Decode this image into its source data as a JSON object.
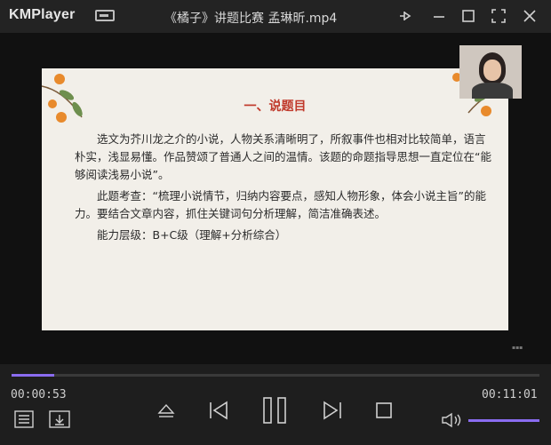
{
  "app": {
    "logo": "KMPlayer",
    "title": "《橘子》讲题比赛 孟琳昕.mp4"
  },
  "slide": {
    "heading": "一、说题目",
    "paragraphs": [
      "选文为芥川龙之介的小说，人物关系清晰明了，所叙事件也相对比较简单，语言朴实，浅显易懂。作品赞颂了普通人之间的温情。该题的命题指导思想一直定位在“能够阅读浅易小说”。",
      "此题考查：“梳理小说情节，归纳内容要点，感知人物形象，体会小说主旨”的能力。要结合文章内容，抓住关键词句分析理解，简洁准确表述。",
      "能力层级：B+C级（理解+分析综合）"
    ]
  },
  "playback": {
    "current_time": "00:00:53",
    "total_time": "00:11:01",
    "progress": 0.08,
    "volume": 1.0,
    "accent": "#8a6cf0"
  }
}
